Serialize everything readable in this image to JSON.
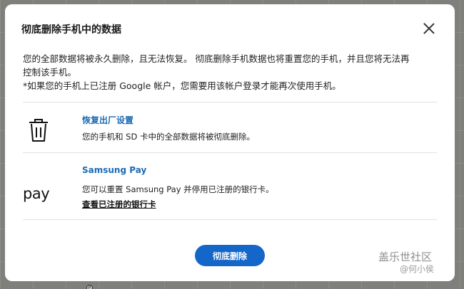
{
  "dialog": {
    "title": "彻底删除手机中的数据",
    "description_line1": "您的全部数据将被永久删除，且无法恢复。 彻底删除手机数据也将重置您的手机，并且您将无法再",
    "description_line2": "控制该手机。",
    "description_line3": "*如果您的手机上已注册 Google 帐户，您需要用该帐户登录才能再次使用手机。",
    "options": [
      {
        "icon": "trash-icon",
        "title": "恢复出厂设置",
        "description": "您的手机和 SD 卡中的全部数据将被彻底删除。"
      },
      {
        "icon": "samsung-pay-icon",
        "icon_text": "pay",
        "title": "Samsung Pay",
        "description": "您可以重置 Samsung Pay 并停用已注册的银行卡。",
        "link": "查看已注册的银行卡"
      }
    ],
    "confirm_button": "彻底删除"
  },
  "watermark": {
    "line1": "盖乐世社区",
    "line2": "@何小侯"
  },
  "colors": {
    "accent": "#1466c9",
    "link": "#1c6ab4",
    "overlay": "#7f7f7c"
  }
}
